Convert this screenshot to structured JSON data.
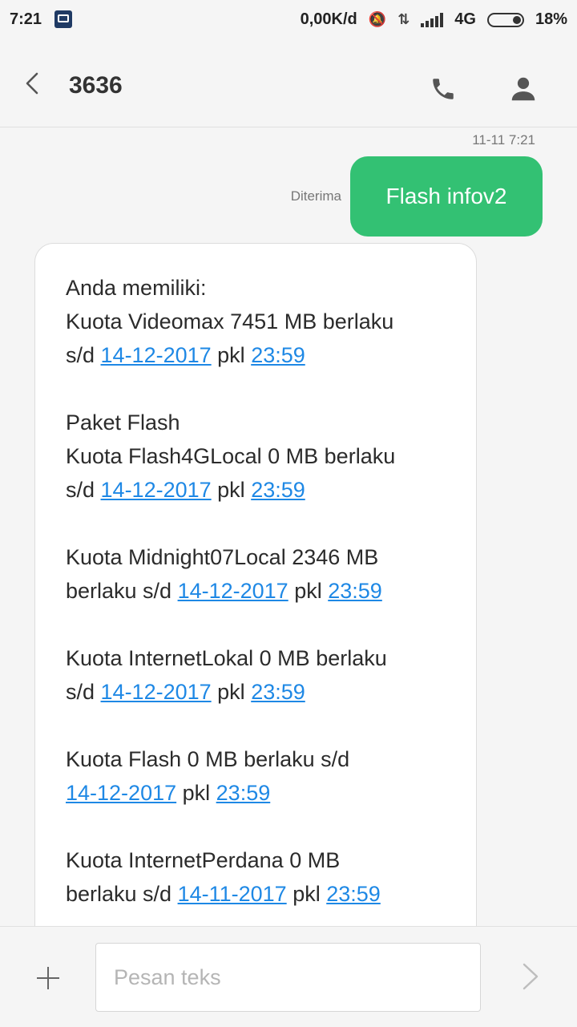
{
  "status_bar": {
    "time": "7:21",
    "speed": "0,00K/d",
    "network": "4G",
    "battery": "18%"
  },
  "header": {
    "title": "3636",
    "icons": [
      "back-icon",
      "call-icon",
      "person-icon"
    ]
  },
  "conversation": {
    "timestamp": "11-11 7:21",
    "sent": {
      "status": "Diterima",
      "text": "Flash infov2"
    },
    "received": {
      "paragraphs": [
        {
          "lines": [
            "Anda memiliki:",
            "Kuota Videomax 7451 MB berlaku"
          ],
          "prefix": "s/d ",
          "date": "14-12-2017",
          "mid": " pkl ",
          "time": "23:59"
        },
        {
          "lines": [
            "Paket Flash",
            "Kuota Flash4GLocal 0 MB berlaku"
          ],
          "prefix": "s/d ",
          "date": "14-12-2017",
          "mid": " pkl ",
          "time": "23:59"
        },
        {
          "lines": [
            "Kuota Midnight07Local 2346 MB"
          ],
          "prefix": "berlaku s/d ",
          "date": "14-12-2017",
          "mid": " pkl ",
          "time": "23:59"
        },
        {
          "lines": [
            "Kuota InternetLokal 0 MB berlaku"
          ],
          "prefix": "s/d ",
          "date": "14-12-2017",
          "mid": " pkl ",
          "time": "23:59"
        },
        {
          "lines": [
            "Kuota Flash 0 MB berlaku s/d"
          ],
          "prefix": "",
          "date": "14-12-2017",
          "mid": " pkl ",
          "time": "23:59"
        },
        {
          "lines": [
            "Kuota InternetPerdana 0 MB"
          ],
          "prefix": "berlaku s/d ",
          "date": "14-11-2017",
          "mid": " pkl ",
          "time": "23:59"
        }
      ]
    }
  },
  "composer": {
    "placeholder": "Pesan teks",
    "icons": [
      "add-icon",
      "send-icon"
    ]
  },
  "colors": {
    "sent_bubble": "#33c173",
    "link": "#1e88e5",
    "background": "#f5f5f5"
  }
}
